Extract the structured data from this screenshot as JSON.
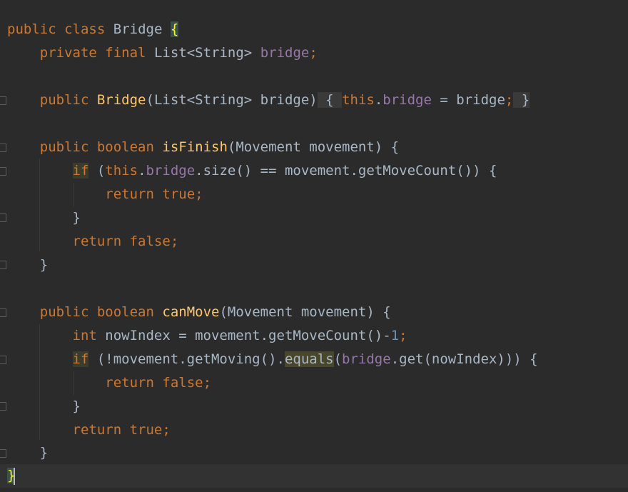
{
  "code": {
    "l1": {
      "kw1": "public",
      "kw2": "class",
      "name": "Bridge",
      "brace": "{"
    },
    "l2": {
      "kw1": "private",
      "kw2": "final",
      "type": "List<String>",
      "field": "bridge",
      "semi": ";"
    },
    "l3": {
      "kw1": "public",
      "fn": "Bridge",
      "params": "(List<String> bridge)",
      "open": "{",
      "this": "this",
      "dot": ".",
      "field": "bridge",
      "assign": " = bridge",
      "semi": ";",
      "close": "}"
    },
    "l4": {
      "kw1": "public",
      "kw2": "boolean",
      "fn": "isFinish",
      "params": "(Movement movement) {"
    },
    "l5": {
      "kw": "if",
      "p1": " (",
      "this": "this",
      "dot": ".",
      "field": "bridge",
      "rest": ".size() == movement.getMoveCount()) {"
    },
    "l6": {
      "kw": "return",
      "kw2": "true",
      "semi": ";"
    },
    "l7": {
      "brace": "}"
    },
    "l8": {
      "kw": "return",
      "kw2": "false",
      "semi": ";"
    },
    "l9": {
      "brace": "}"
    },
    "l10": {
      "kw1": "public",
      "kw2": "boolean",
      "fn": "canMove",
      "params": "(Movement movement) {"
    },
    "l11": {
      "kw": "int",
      "rest": " nowIndex = movement.getMoveCount()-",
      "num": "1",
      "semi": ";"
    },
    "l12": {
      "kw": "if",
      "p1": " (!movement.getMoving().",
      "eq": "equals",
      "p2": "(",
      "field": "bridge",
      "rest": ".get(nowIndex))) {"
    },
    "l13": {
      "kw": "return",
      "kw2": "false",
      "semi": ";"
    },
    "l14": {
      "brace": "}"
    },
    "l15": {
      "kw": "return",
      "kw2": "true",
      "semi": ";"
    },
    "l16": {
      "brace": "}"
    },
    "l17": {
      "brace": "}"
    }
  },
  "colors": {
    "background": "#2b2b2b",
    "keyword": "#cc7832",
    "field": "#9876aa",
    "function": "#ffc66d",
    "number": "#6897bb",
    "text": "#a9b7c6"
  }
}
